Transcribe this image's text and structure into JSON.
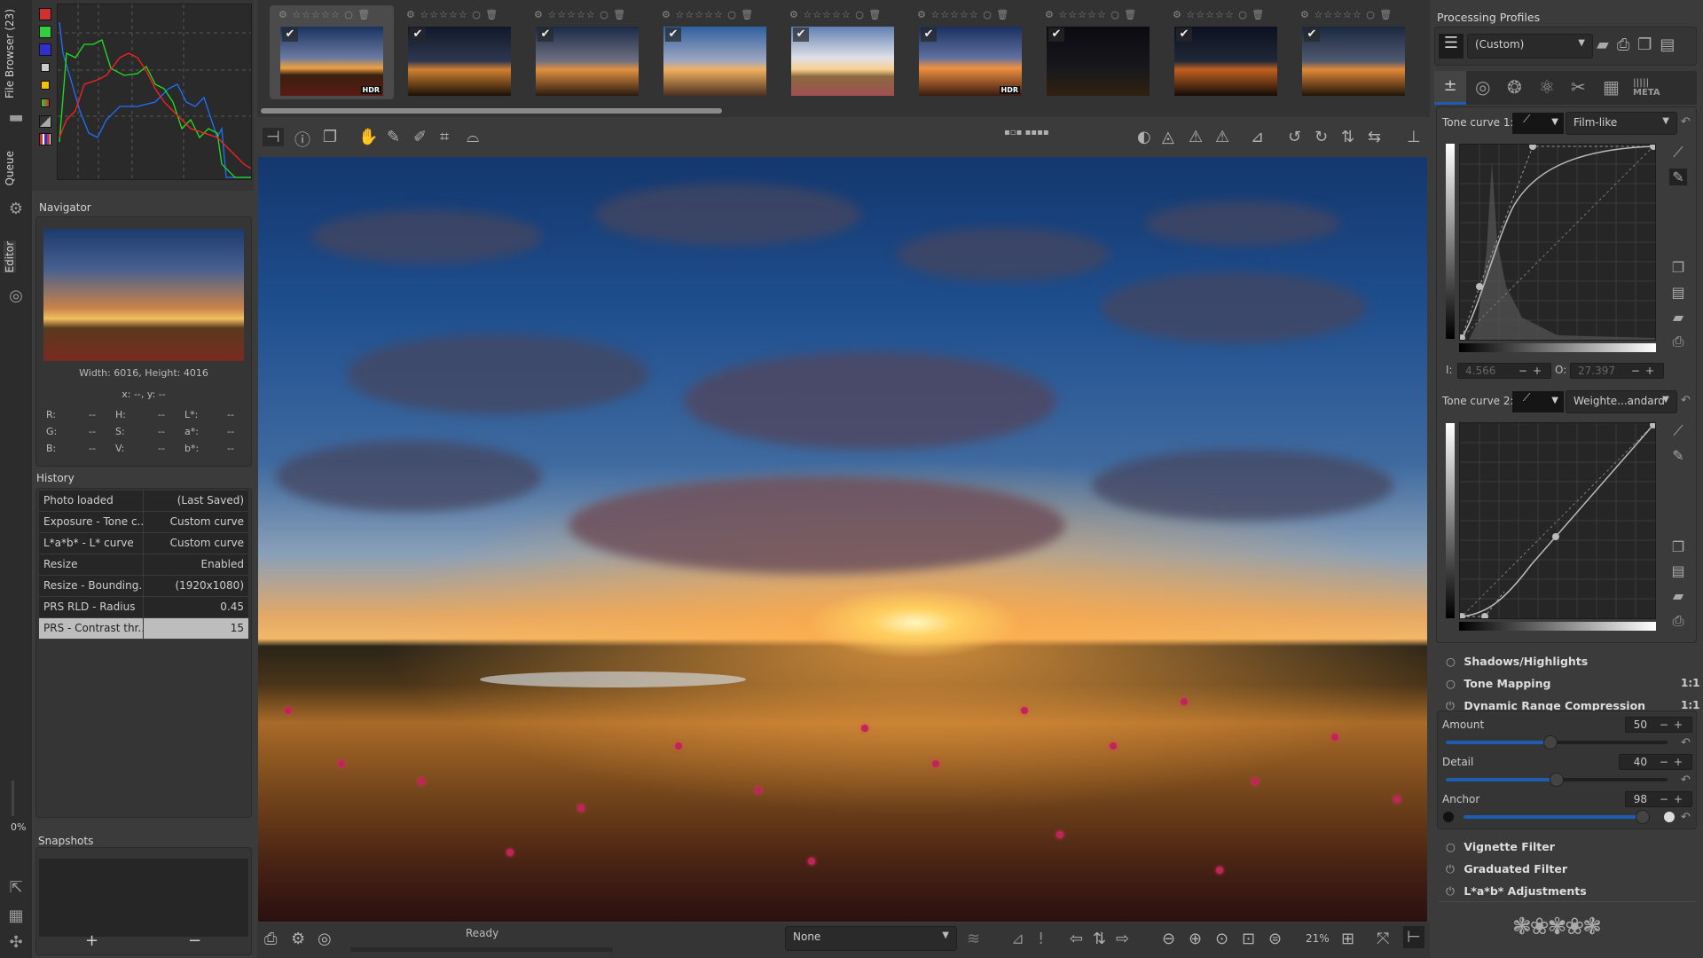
{
  "sidebar_tabs": {
    "file_browser": "File Browser (23)",
    "queue": "Queue",
    "editor": "Editor",
    "progress": "0%"
  },
  "histogram": {
    "channel_colors": {
      "red": "#ff2020",
      "green": "#20e020",
      "blue": "#2060ff"
    }
  },
  "navigator": {
    "title": "Navigator",
    "dimensions": "Width: 6016, Height: 4016",
    "coords": "x: --, y: --",
    "readouts": [
      [
        "R:",
        "--",
        "H:",
        "--",
        "L*:",
        "--"
      ],
      [
        "G:",
        "--",
        "S:",
        "--",
        "a*:",
        "--"
      ],
      [
        "B:",
        "--",
        "V:",
        "--",
        "b*:",
        "--"
      ]
    ]
  },
  "history": {
    "title": "History",
    "rows": [
      {
        "action": "Photo loaded",
        "value": "(Last Saved)"
      },
      {
        "action": "Exposure - Tone c...",
        "value": "Custom curve"
      },
      {
        "action": "L*a*b* - L* curve",
        "value": "Custom curve"
      },
      {
        "action": "Resize",
        "value": "Enabled"
      },
      {
        "action": "Resize - Bounding...",
        "value": "(1920x1080)"
      },
      {
        "action": "PRS RLD - Radius",
        "value": "0.45"
      },
      {
        "action": "PRS - Contrast thr...",
        "value": "15",
        "selected": true
      }
    ]
  },
  "snapshots": {
    "title": "Snapshots",
    "add": "+",
    "remove": "−"
  },
  "filmstrip": {
    "thumbnails": [
      {
        "hdr": "HDR",
        "selected": true
      },
      {
        "hdr": ""
      },
      {
        "hdr": ""
      },
      {
        "hdr": ""
      },
      {
        "hdr": ""
      },
      {
        "hdr": "HDR"
      },
      {
        "hdr": ""
      },
      {
        "hdr": ""
      },
      {
        "hdr": ""
      }
    ],
    "stars": "☆☆☆☆☆"
  },
  "statusbar": {
    "status": "Ready",
    "mode_combo": "None",
    "zoom": "21%"
  },
  "right": {
    "profiles_title": "Processing Profiles",
    "profile": "(Custom)",
    "tone_curve_1": {
      "label": "Tone curve 1:",
      "mode": "Film-like",
      "input_label": "I:",
      "input": "4.566",
      "output_label": "O:",
      "output": "27.397"
    },
    "tone_curve_2": {
      "label": "Tone curve 2:",
      "mode": "Weighte...andard"
    },
    "tools": [
      {
        "name": "Shadows/Highlights",
        "state": "off",
        "ratio": ""
      },
      {
        "name": "Tone Mapping",
        "state": "off",
        "ratio": "1:1"
      },
      {
        "name": "Dynamic Range Compression",
        "state": "on",
        "ratio": "1:1"
      },
      {
        "name": "Vignette Filter",
        "state": "off",
        "ratio": ""
      },
      {
        "name": "Graduated Filter",
        "state": "on",
        "ratio": ""
      },
      {
        "name": "L*a*b* Adjustments",
        "state": "on",
        "ratio": ""
      }
    ],
    "drc": {
      "amount_label": "Amount",
      "amount": "50",
      "detail_label": "Detail",
      "detail": "40",
      "anchor_label": "Anchor",
      "anchor": "98",
      "amount_fraction": 0.47,
      "detail_fraction": 0.5,
      "anchor_fraction": 0.96
    },
    "accent": "#1d5cb0"
  }
}
